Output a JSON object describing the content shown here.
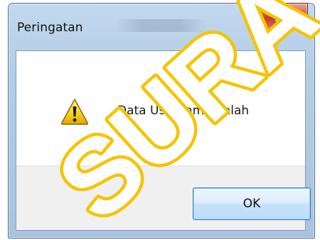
{
  "dialog": {
    "title": "Peringatan",
    "close_label": "X",
    "message": "Data Username Salah",
    "icon": "warning-icon",
    "ok_label": "OK"
  },
  "watermark": {
    "text": "SURA",
    "color": "#f5c400"
  },
  "colors": {
    "title_bar": "#b4cde6",
    "close_button": "#c23a1d",
    "ok_button_border": "#3c7fb1"
  }
}
